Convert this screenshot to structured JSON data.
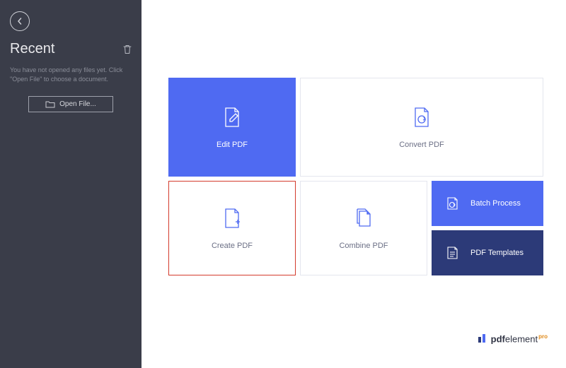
{
  "window_controls": {
    "min": "—",
    "max": "□",
    "close": "✕"
  },
  "sidebar": {
    "title": "Recent",
    "hint": "You have not opened any files yet. Click \"Open File\" to choose a document.",
    "open_file_label": "Open File..."
  },
  "tiles": {
    "edit": "Edit PDF",
    "convert": "Convert PDF",
    "create": "Create PDF",
    "combine": "Combine PDF",
    "batch": "Batch Process",
    "templates": "PDF Templates"
  },
  "brand": {
    "name_bold": "pdf",
    "name_rest": "element",
    "suffix": "pro"
  }
}
